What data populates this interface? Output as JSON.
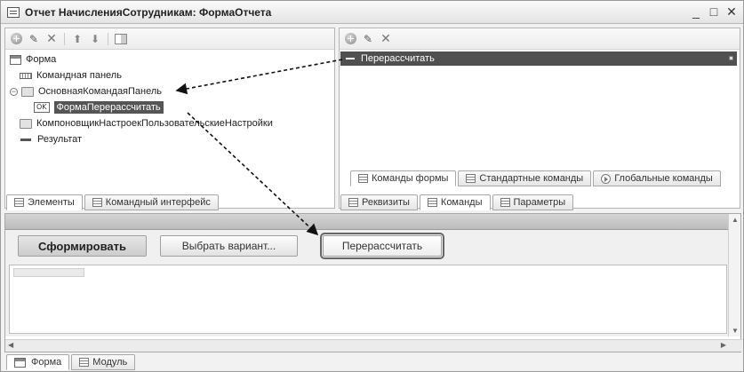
{
  "window": {
    "title": "Отчет НачисленияСотрудникам: ФормаОтчета",
    "min": "_",
    "max": "□",
    "close": "✕"
  },
  "left_panel": {
    "toolbar_icons": [
      "add-icon",
      "edit-icon",
      "delete-icon",
      "move-up-icon",
      "move-down-icon",
      "form-settings-icon"
    ],
    "tree": [
      {
        "label": "Форма",
        "icon": "form-icon"
      },
      {
        "label": "Командная панель",
        "icon": "command-panel-icon"
      },
      {
        "label": "ОсновнаяКомандаяПанель",
        "icon": "folder-icon"
      },
      {
        "label": "ФормаПерерассчитать",
        "icon": "ok-button-icon",
        "badge": "OK"
      },
      {
        "label": "КомпоновщикНастроекПользовательскиеНастройки",
        "icon": "folder-icon"
      },
      {
        "label": "Результат",
        "icon": "field-icon"
      }
    ],
    "tabs": [
      "Элементы",
      "Командный интерфейс"
    ]
  },
  "right_panel": {
    "toolbar_icons": [
      "add-icon",
      "edit-icon",
      "delete-icon"
    ],
    "commands": [
      "Перерассчитать"
    ],
    "bottom_tabs": [
      "Команды формы",
      "Стандартные команды",
      "Глобальные команды"
    ],
    "tabs": [
      "Реквизиты",
      "Команды",
      "Параметры"
    ]
  },
  "preview": {
    "buttons": {
      "generate": "Сформировать",
      "choose_variant": "Выбрать вариант...",
      "recalculate": "Перерассчитать"
    }
  },
  "bottom_tabs": [
    "Форма",
    "Модуль"
  ]
}
